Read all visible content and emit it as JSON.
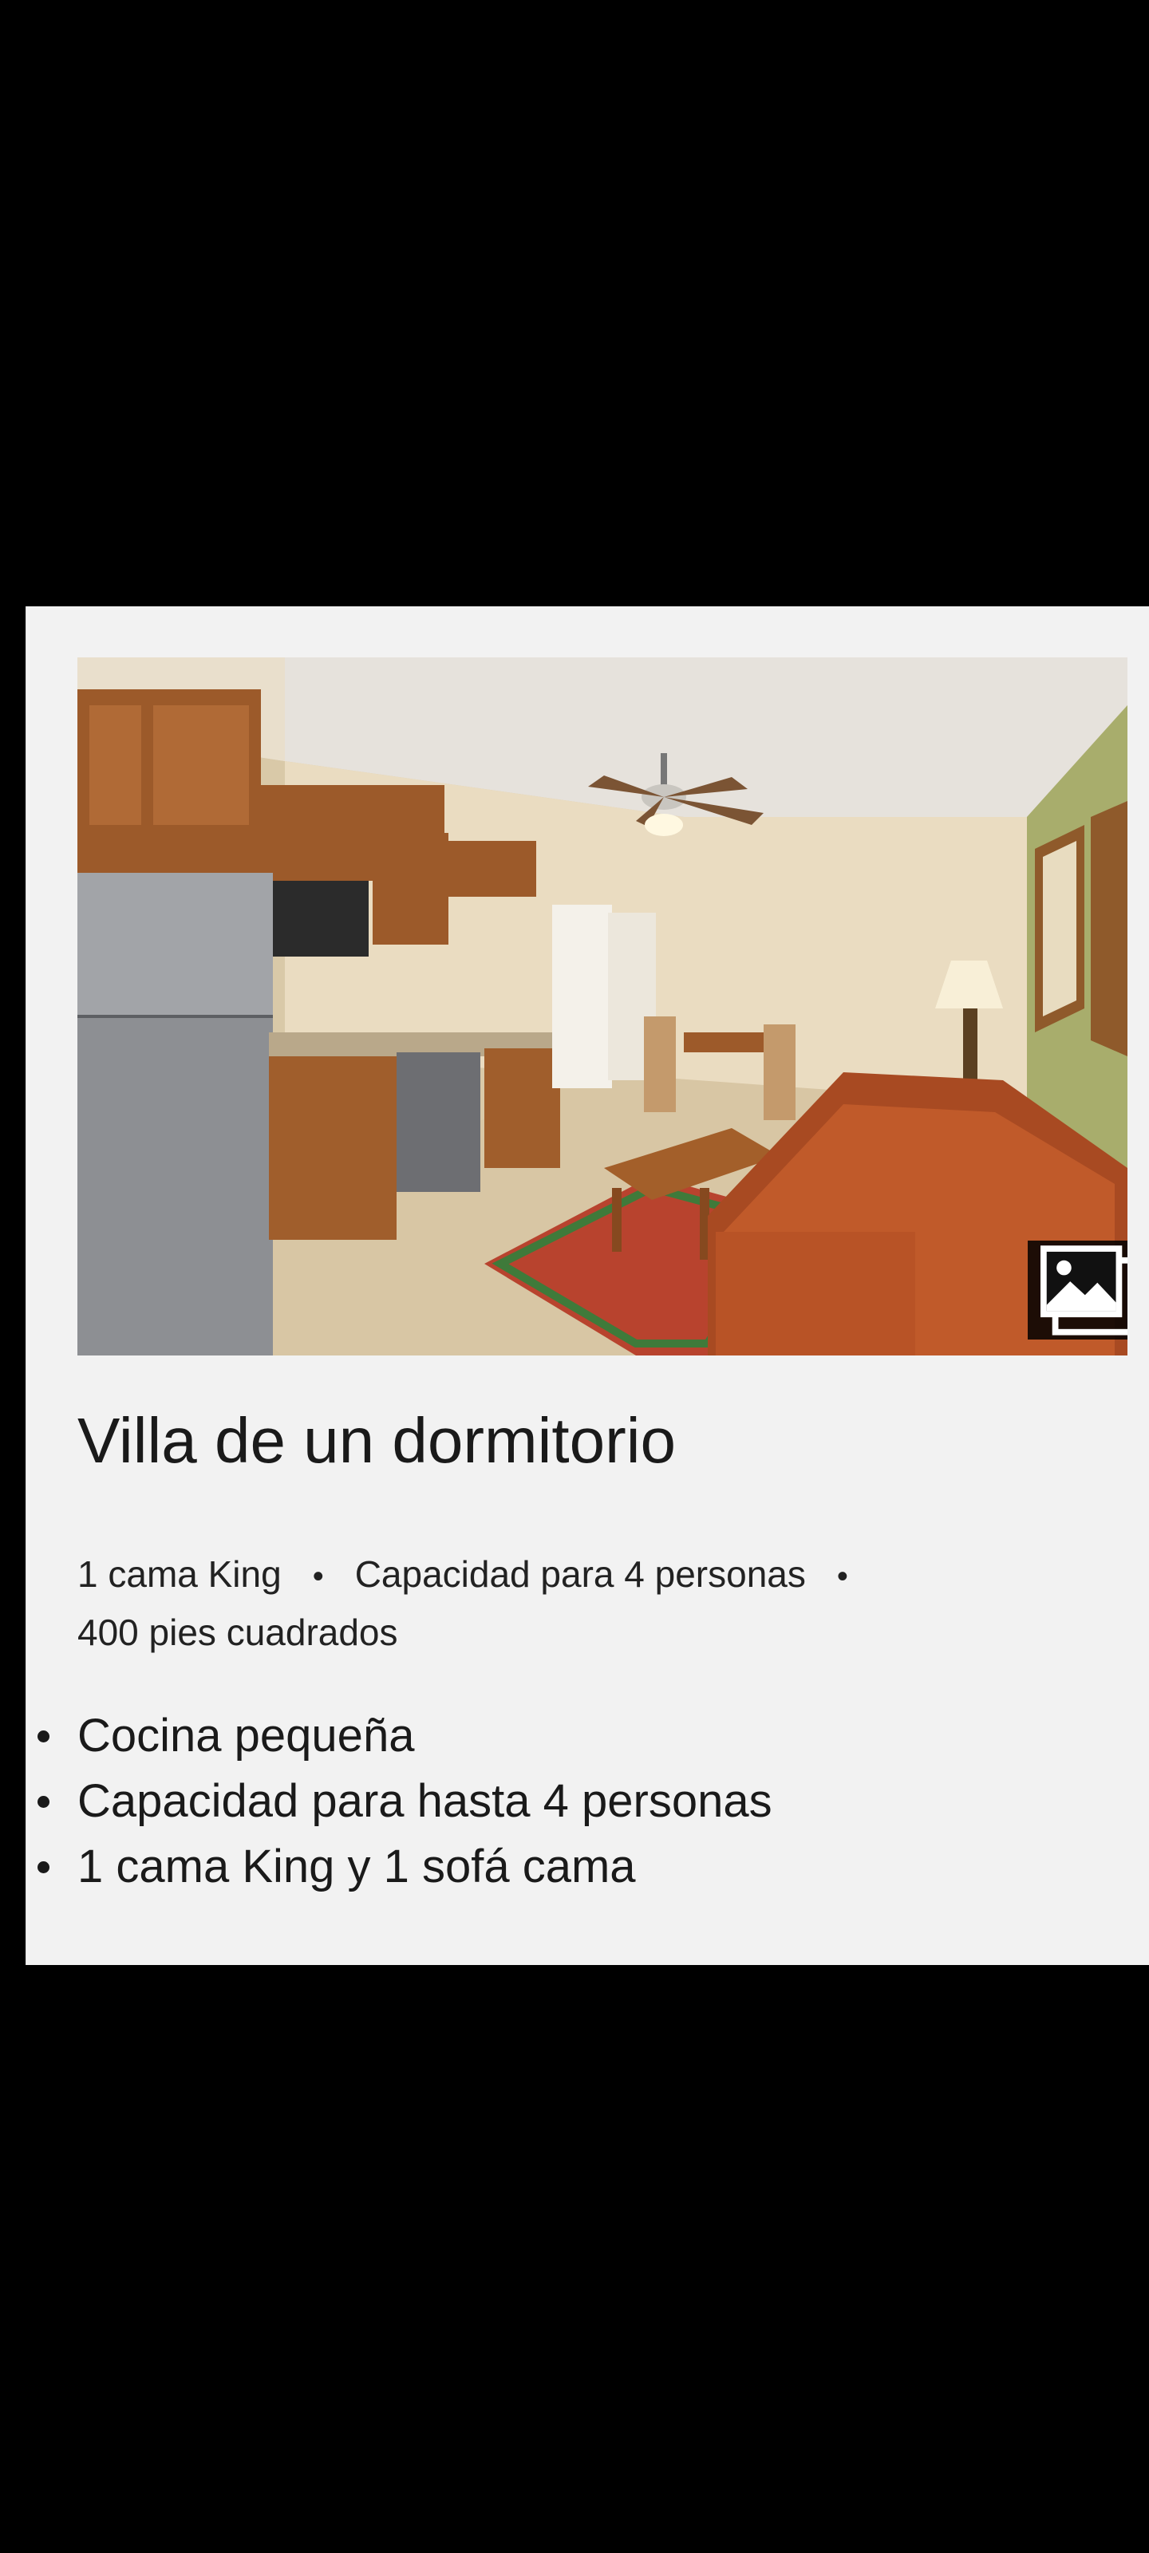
{
  "room": {
    "photo_alt": "Villa de un dormitorio",
    "title": "Villa de un dormitorio",
    "specs": {
      "bed": "1 cama King",
      "capacity": "Capacidad para 4 personas",
      "size": "400 pies cuadrados",
      "separator": "•"
    },
    "features": [
      "Cocina pequeña",
      "Capacidad para hasta 4 personas",
      "1 cama King y 1 sofá cama"
    ]
  },
  "icons": {
    "gallery": "image-gallery-icon"
  }
}
